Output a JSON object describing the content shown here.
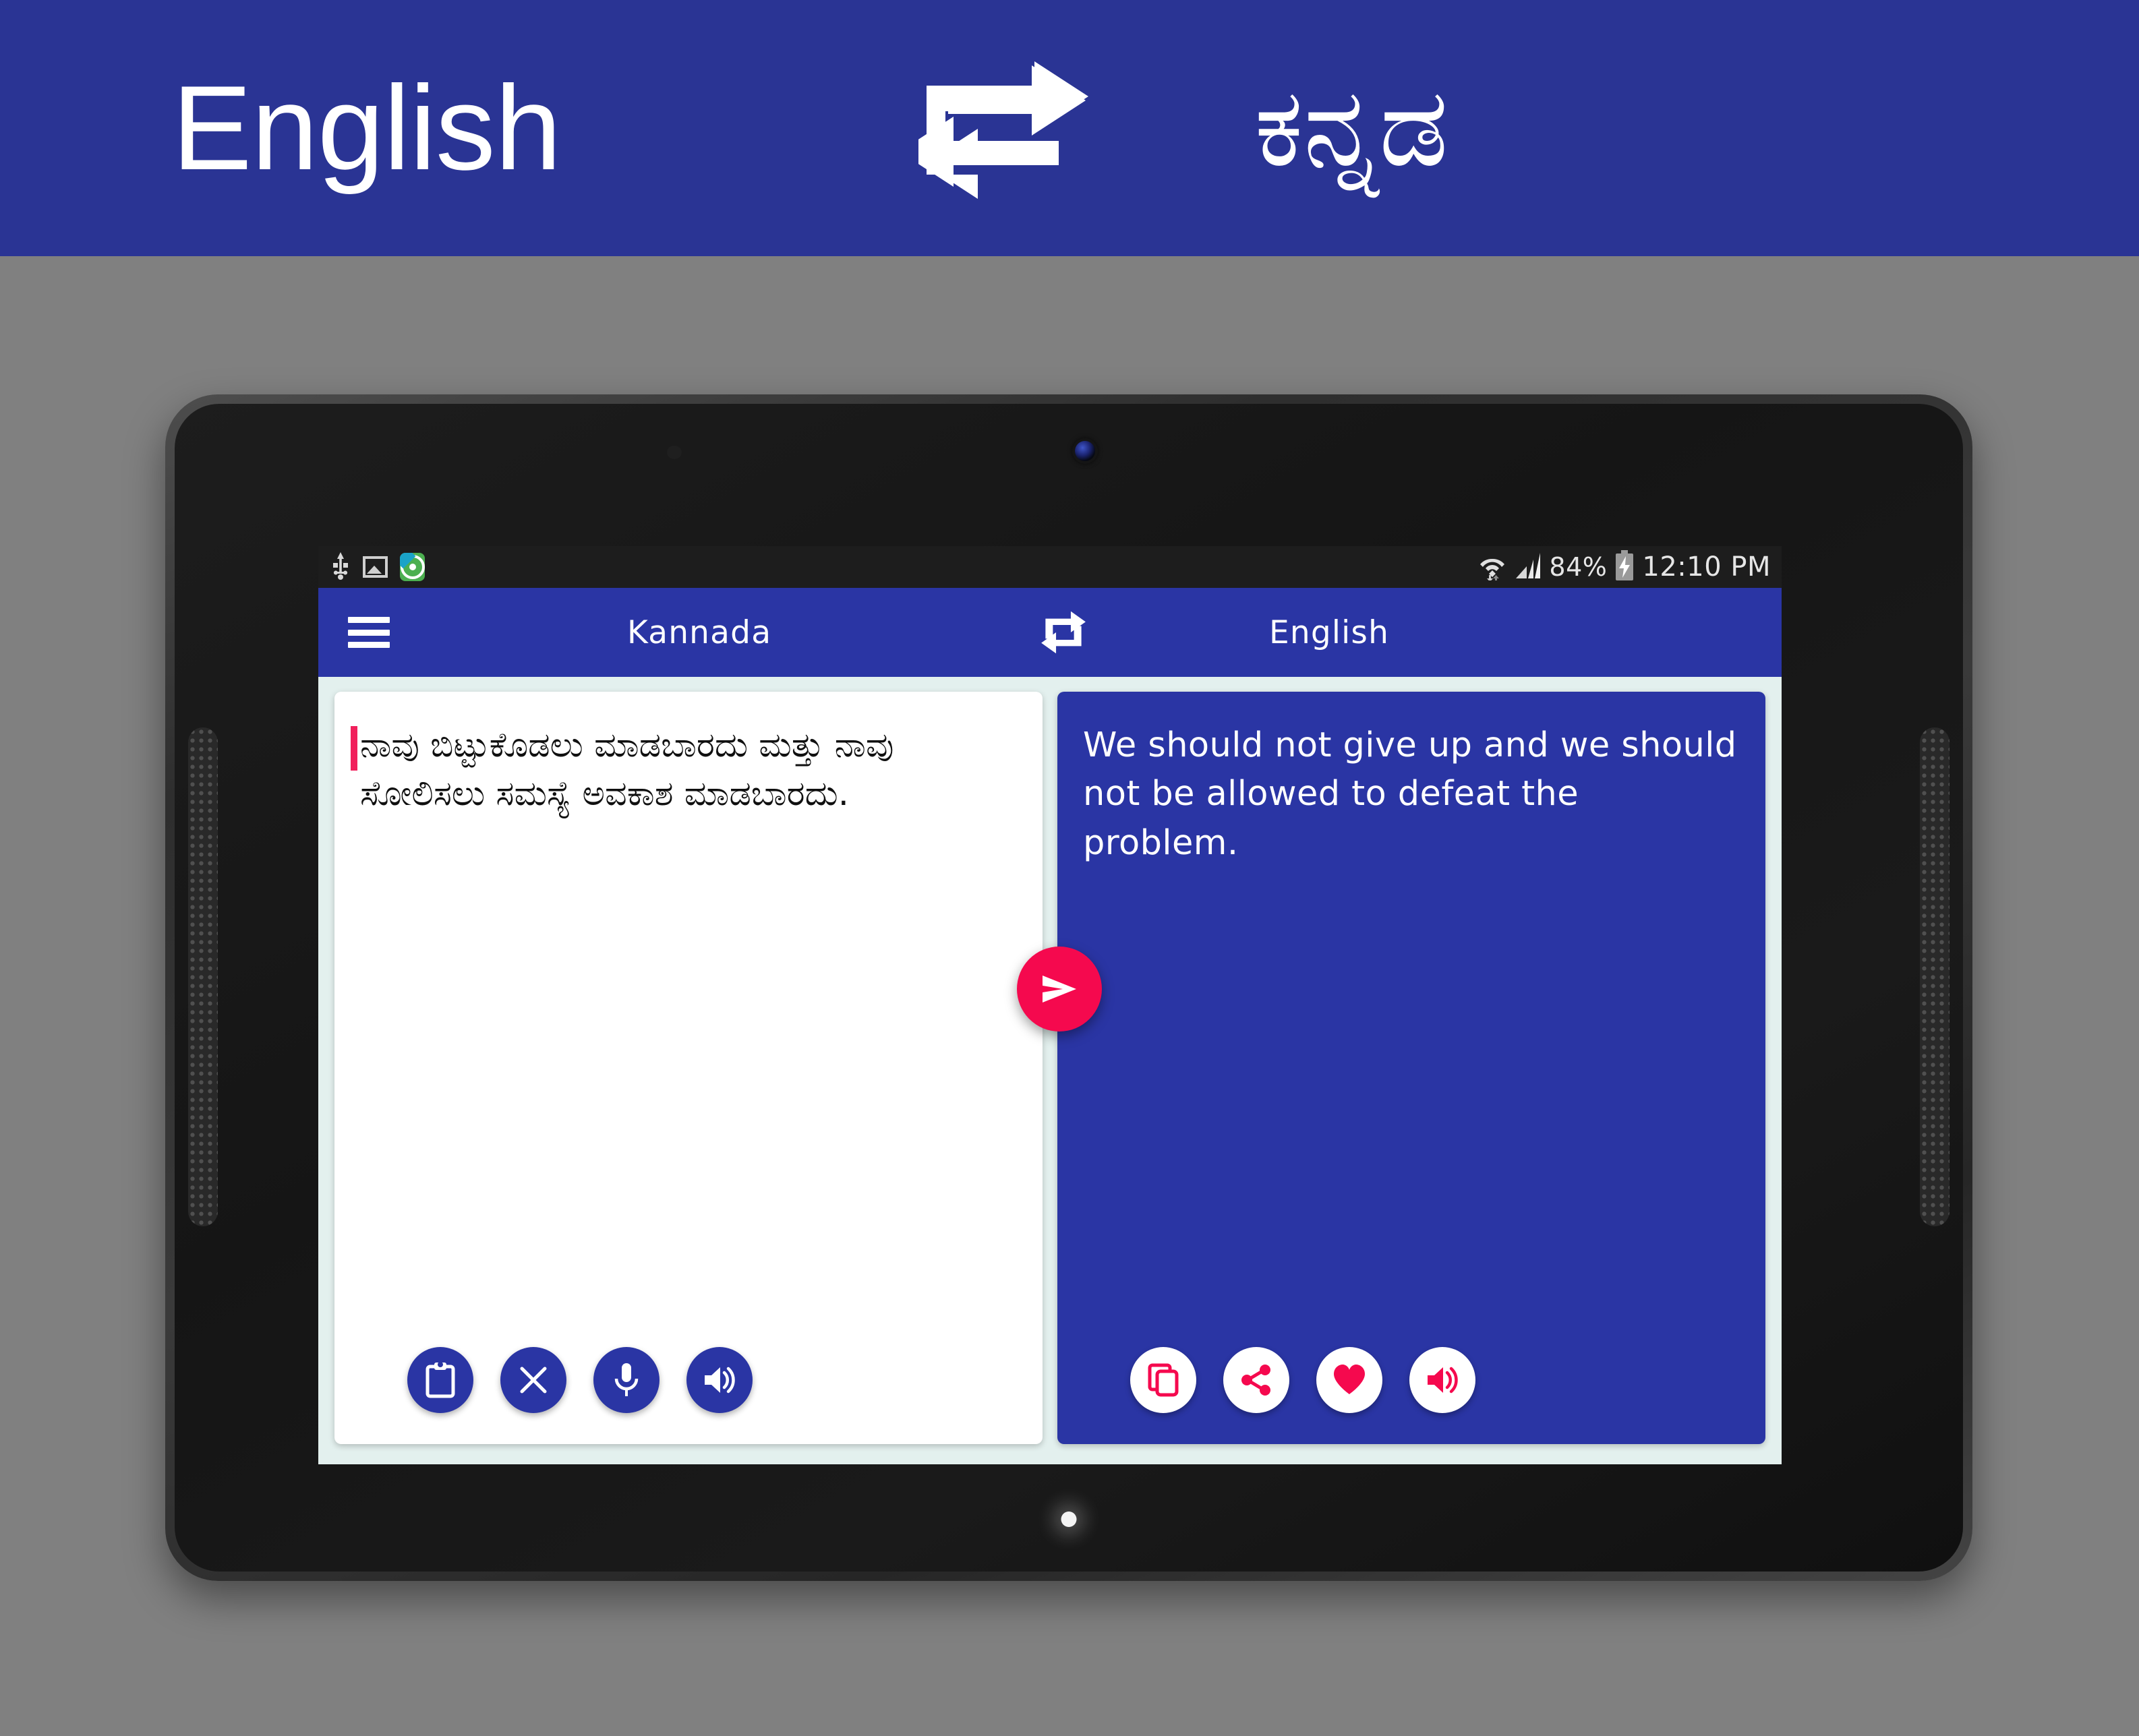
{
  "promo_banner": {
    "left_language": "English",
    "right_language": "ಕನ್ನಡ",
    "swap_icon": "swap-arrows-icon",
    "background_color": "#2a3494",
    "text_color": "#ffffff"
  },
  "device": {
    "type": "android-tablet",
    "front_camera": "front-camera",
    "home_led": "notification-led"
  },
  "status_bar": {
    "background_color": "#1d1d1d",
    "left_icons": [
      "usb-icon",
      "screenshot-image-icon",
      "screen-recorder-app-icon"
    ],
    "wifi_icon": "wifi-icon",
    "signal_icon": "cellular-signal-icon",
    "battery_percent": "84%",
    "battery_icon": "battery-charging-icon",
    "clock": "12:10 PM"
  },
  "app_bar": {
    "background_color": "#2a35a4",
    "menu_icon": "hamburger-menu-icon",
    "source_language": "Kannada",
    "swap_icon": "swap-languages-icon",
    "target_language": "English"
  },
  "source_panel": {
    "background_color": "#ffffff",
    "text": "ನಾವು ಬಿಟ್ಟುಕೊಡಲು ಮಾಡಬಾರದು ಮತ್ತು ನಾವು ಸೋಲಿಸಲು ಸಮಸ್ಯೆ ಅವಕಾಶ ಮಾಡಬಾರದು.",
    "cursor_color": "#f1205c",
    "actions": [
      {
        "name": "paste-button",
        "icon": "clipboard-paste-icon"
      },
      {
        "name": "clear-button",
        "icon": "close-x-icon"
      },
      {
        "name": "voice-input-button",
        "icon": "microphone-icon"
      },
      {
        "name": "speak-source-button",
        "icon": "speaker-volume-icon"
      }
    ]
  },
  "target_panel": {
    "background_color": "#2a35a4",
    "text": "We should not give up and we should not be allowed to defeat the problem.",
    "actions": [
      {
        "name": "copy-button",
        "icon": "copy-icon"
      },
      {
        "name": "share-button",
        "icon": "share-icon"
      },
      {
        "name": "favorite-button",
        "icon": "heart-icon"
      },
      {
        "name": "speak-target-button",
        "icon": "speaker-volume-icon"
      }
    ]
  },
  "translate_fab": {
    "icon": "send-arrow-icon",
    "background_color": "#f5094e"
  },
  "colors": {
    "brand_blue": "#2a35a4",
    "banner_blue": "#2a3494",
    "accent_pink": "#f5094e",
    "screen_background": "#e3f0ee",
    "page_background": "#808080"
  }
}
